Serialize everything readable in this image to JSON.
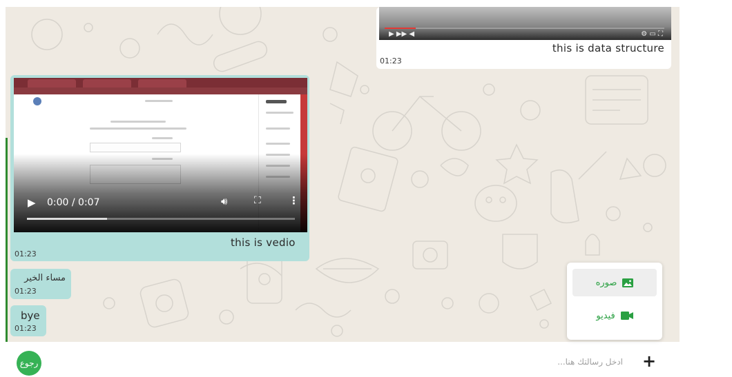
{
  "colors": {
    "chat_background": "#efeae2",
    "incoming_bubble": "#b2dfdb",
    "outgoing_bubble": "#ffffff",
    "accent_green": "#36b255",
    "menu_icon_green": "#2aa042"
  },
  "messages": [
    {
      "type": "video",
      "direction": "outgoing",
      "caption": "this is data structure",
      "time": "01:23"
    },
    {
      "type": "video",
      "direction": "incoming",
      "caption": "this is vedio",
      "time": "01:23",
      "player": {
        "current_time": "0:00 / 0:07",
        "progress_fraction": 0.3,
        "playing": false
      }
    },
    {
      "type": "text",
      "direction": "incoming",
      "text": "مساء الخير",
      "time": "01:23"
    },
    {
      "type": "text",
      "direction": "incoming",
      "text": "bye",
      "time": "01:23"
    }
  ],
  "attach_menu": {
    "items": [
      {
        "label": "صوره",
        "icon": "image-icon",
        "selected": true
      },
      {
        "label": "فيديو",
        "icon": "video-camera-icon",
        "selected": false
      }
    ]
  },
  "composer": {
    "placeholder": "ادخل رسالتك هنا...",
    "attach_icon": "plus-icon",
    "back_label": "رجوع"
  }
}
